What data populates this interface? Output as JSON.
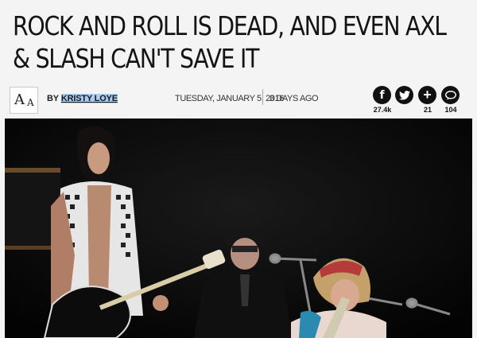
{
  "article": {
    "headline": "ROCK AND ROLL IS DEAD, AND EVEN AXL & SLASH CAN'T SAVE IT"
  },
  "font_toggle": {
    "large": "A",
    "small": "A"
  },
  "byline": {
    "prefix": "BY",
    "author": "KRISTY LOYE"
  },
  "date": "TUESDAY, JANUARY 5, 2016",
  "relative_time": "3 DAYS AGO",
  "share": [
    {
      "icon": "facebook-icon",
      "glyph": "f",
      "count": "27.4k"
    },
    {
      "icon": "twitter-icon",
      "glyph": "🐦",
      "count": ""
    },
    {
      "icon": "plus-icon",
      "glyph": "+",
      "count": "21"
    },
    {
      "icon": "comment-icon",
      "glyph": "💬",
      "count": "104"
    }
  ],
  "colors": {
    "author_highlight": "#a9cdf3",
    "share_bg": "#111111",
    "page_bg": "#f4f4f4"
  }
}
